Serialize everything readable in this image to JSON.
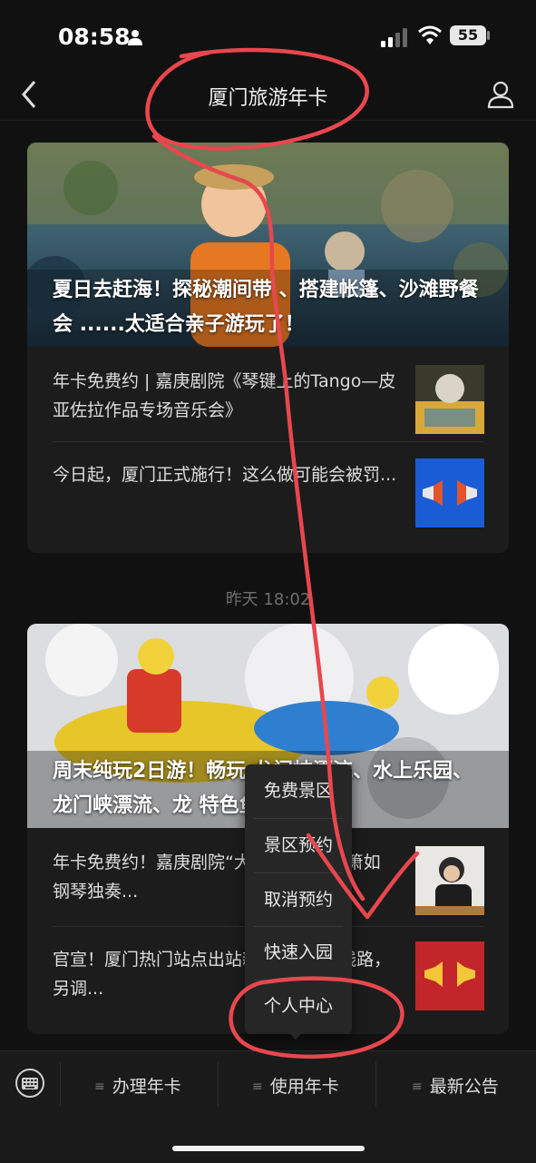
{
  "status_bar": {
    "time": "08:58",
    "battery": "55"
  },
  "nav": {
    "title": "厦门旅游年卡"
  },
  "card1": {
    "headline": "夏日去赶海！探秘潮间带 、搭建帐篷、沙滩野餐会 ......太适合亲子游玩了！",
    "items": [
      {
        "text": "年卡免费约 | 嘉庚剧院《琴键上的Tango—皮亚佐拉作品专场音乐会》"
      },
      {
        "text": "今日起，厦门正式施行！这么做可能会被罚..."
      }
    ]
  },
  "timestamp": "昨天 18:02",
  "card2": {
    "headline": "周末纯玩2日游！畅玩 龙门峡漂流、水上乐园、龙门峡漂流、龙 特色鱼...",
    "items": [
      {
        "text": "年卡免费约！嘉庚剧院“大师魂”——温箫如钢琴独奏..."
      },
      {
        "text": "官宣！厦门热门站点出站新增1条公交线路，另调..."
      }
    ]
  },
  "popup_menu": {
    "items": [
      "免费景区",
      "景区预约",
      "取消预约",
      "快速入园",
      "个人中心"
    ]
  },
  "bottom_bar": {
    "tabs": [
      "办理年卡",
      "使用年卡",
      "最新公告"
    ]
  },
  "colors": {
    "annotation": "#e8474d",
    "background": "#111111",
    "card": "#1c1c1c"
  }
}
